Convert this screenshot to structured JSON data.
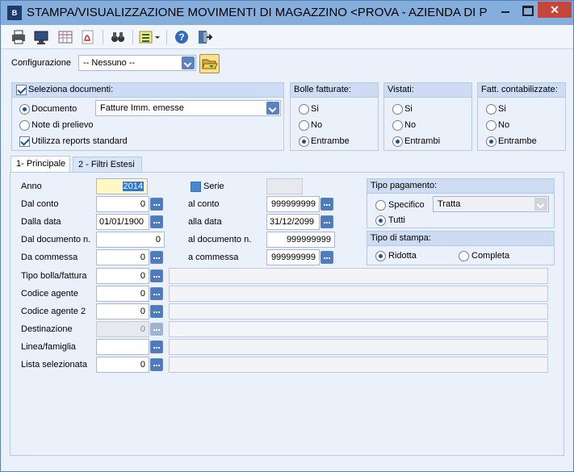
{
  "window": {
    "title": "STAMPA/VISUALIZZAZIONE MOVIMENTI DI MAGAZZINO <PROVA - AZIENDA DI PR...",
    "app_icon_text": "B",
    "close_label": "✕"
  },
  "config": {
    "label": "Configurazione",
    "value": "-- Nessuno --"
  },
  "documenti": {
    "header": "Seleziona documenti:",
    "documento_label": "Documento",
    "documento_value": "Fatture Imm. emesse",
    "note_label": "Note di prelievo",
    "reports_label": "Utilizza reports standard"
  },
  "bolle": {
    "header": "Bolle fatturate:",
    "opt1": "Si",
    "opt2": "No",
    "opt3": "Entrambe"
  },
  "vistati": {
    "header": "Vistati:",
    "opt1": "Si",
    "opt2": "No",
    "opt3": "Entrambi"
  },
  "fatt": {
    "header": "Fatt. contabilizzate:",
    "opt1": "Si",
    "opt2": "No",
    "opt3": "Entrambe"
  },
  "tabs": [
    {
      "label": "1- Principale"
    },
    {
      "label": "2 - Filtri Estesi"
    }
  ],
  "form": {
    "anno_label": "Anno",
    "anno_value": "2014",
    "serie_label": "Serie",
    "dal_conto_label": "Dal conto",
    "dal_conto_value": "0",
    "al_conto_label": "al conto",
    "al_conto_value": "999999999",
    "dalla_data_label": "Dalla data",
    "dalla_data_value": "01/01/1900",
    "alla_data_label": "alla data",
    "alla_data_value": "31/12/2099",
    "dal_doc_label": "Dal documento n.",
    "dal_doc_value": "0",
    "al_doc_label": "al documento n.",
    "al_doc_value": "999999999",
    "da_commessa_label": "Da commessa",
    "da_commessa_value": "0",
    "a_commessa_label": "a commessa",
    "a_commessa_value": "999999999",
    "tipo_bolla_label": "Tipo bolla/fattura",
    "tipo_bolla_value": "0",
    "agente_label": "Codice agente",
    "agente_value": "0",
    "agente2_label": "Codice agente 2",
    "agente2_value": "0",
    "destinazione_label": "Destinazione",
    "destinazione_value": "0",
    "linea_label": "Linea/famiglia",
    "linea_value": "",
    "lista_label": "Lista selezionata",
    "lista_value": "0"
  },
  "pagamento": {
    "header": "Tipo pagamento:",
    "specifico_label": "Specifico",
    "specifico_value": "Tratta",
    "tutti_label": "Tutti"
  },
  "stampa": {
    "header": "Tipo di stampa:",
    "ridotta_label": "Ridotta",
    "completa_label": "Completa"
  }
}
